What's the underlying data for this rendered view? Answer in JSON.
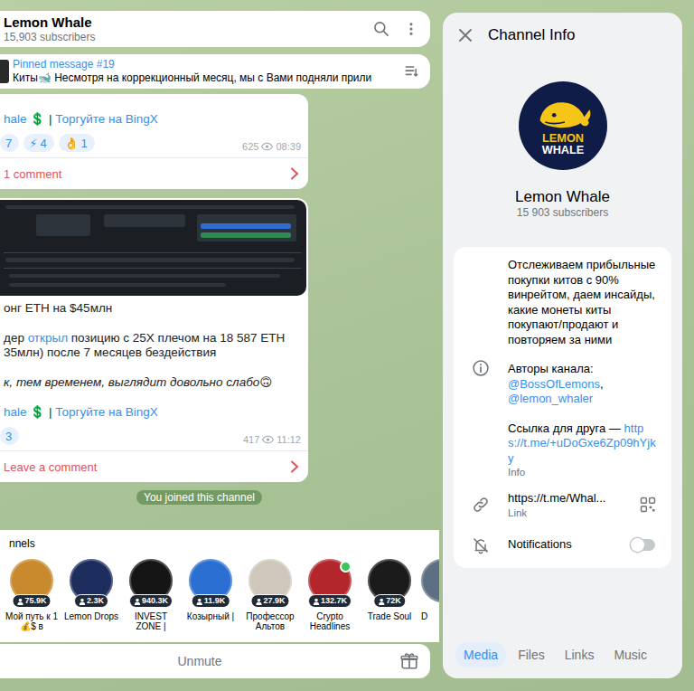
{
  "chat": {
    "title": "Lemon Whale",
    "subtitle": "15,903 subscribers"
  },
  "pinned": {
    "label": "Pinned message #19",
    "text": "Киты🐋 Несмотря на коррекционный месяц, мы с Вами подняли прили"
  },
  "messages": [
    {
      "has_image": false,
      "paragraphs": [
        [
          [
            {
              "text": "hale 💲",
              "link": true,
              "italic": false
            },
            {
              "text": " | ",
              "link": false,
              "italic": false
            },
            {
              "text": "Торгуйте на BingX",
              "link": true,
              "italic": false
            }
          ]
        ]
      ],
      "reactions": [
        {
          "count": "7"
        },
        {
          "emoji": "⚡",
          "count": "4"
        },
        {
          "emoji": "👌",
          "count": "1"
        }
      ],
      "views": "625",
      "time": "08:39",
      "comments": "1 comment"
    },
    {
      "has_image": true,
      "paragraphs": [
        [
          [
            {
              "text": "онг ETH на $45млн",
              "link": false,
              "italic": false
            }
          ]
        ],
        [
          [
            {
              "text": "дер ",
              "link": false,
              "italic": false
            },
            {
              "text": "открыл",
              "link": true,
              "italic": false
            },
            {
              "text": " позицию с 25X плечом на 18 587 ETH",
              "link": false,
              "italic": false
            }
          ],
          [
            {
              "text": "35млн) после 7 месяцев бездействия",
              "link": false,
              "italic": false
            }
          ]
        ],
        [
          [
            {
              "text": "к, тем временем, выглядит довольно слабо🙃",
              "link": false,
              "italic": true
            }
          ]
        ],
        [
          [
            {
              "text": "hale 💲",
              "link": true,
              "italic": false
            },
            {
              "text": " | ",
              "link": false,
              "italic": false
            },
            {
              "text": "Торгуйте на BingX",
              "link": true,
              "italic": false
            }
          ]
        ]
      ],
      "reactions": [
        {
          "count": "3"
        }
      ],
      "views": "417",
      "time": "11:12",
      "comments": "Leave a comment"
    }
  ],
  "joined_notice": "You joined this channel",
  "similar": {
    "label": "nnels",
    "channels": [
      {
        "name": "Мой путь к 1💰$ в",
        "subscribers": "75.9K",
        "color": "#c98a2e",
        "online": false
      },
      {
        "name": "Lemon Drops",
        "subscribers": "2.3K",
        "color": "#1d2d5e",
        "online": false
      },
      {
        "name": "INVEST ZONE |",
        "subscribers": "940.3K",
        "color": "#151515",
        "online": false
      },
      {
        "name": "Козырный |",
        "subscribers": "11.9K",
        "color": "#2b6fd3",
        "online": false
      },
      {
        "name": "Профессор Альтов",
        "subscribers": "27.9K",
        "color": "#cfc7bb",
        "online": false
      },
      {
        "name": "Crypto Headlines",
        "subscribers": "132.7K",
        "color": "#b3262c",
        "online": true
      },
      {
        "name": "Trade Soul",
        "subscribers": "72K",
        "color": "#1b1b1b",
        "online": false
      },
      {
        "name": "D",
        "subscribers": "",
        "color": "#5d6f82",
        "online": false
      }
    ]
  },
  "bottom_bar": {
    "button": "Unmute"
  },
  "info_panel": {
    "title": "Channel Info",
    "logo_text": [
      "LEMON",
      "WHALE"
    ],
    "name": "Lemon Whale",
    "subscribers": "15 903 subscribers",
    "description": "Отслеживаем прибыльные покупки китов с 90% винрейтом, даем инсайды, какие монеты киты покупают/продают и повторяем за ними",
    "authors_label": "Авторы канала:",
    "authors": [
      "@BossOfLemons",
      "@lemon_whaler"
    ],
    "authors_separator": ",",
    "friend_link": {
      "label": "Ссылка для друга — ",
      "url": "https://t.me/+uDoGxe6Zp09hYjky"
    },
    "info_caption": "Info",
    "link": {
      "value": "https://t.me/Whal...",
      "caption": "Link"
    },
    "notifications": {
      "label": "Notifications",
      "on": false
    },
    "tabs": [
      {
        "label": "Media",
        "selected": true
      },
      {
        "label": "Files",
        "selected": false
      },
      {
        "label": "Links",
        "selected": false
      },
      {
        "label": "Music",
        "selected": false
      }
    ]
  }
}
